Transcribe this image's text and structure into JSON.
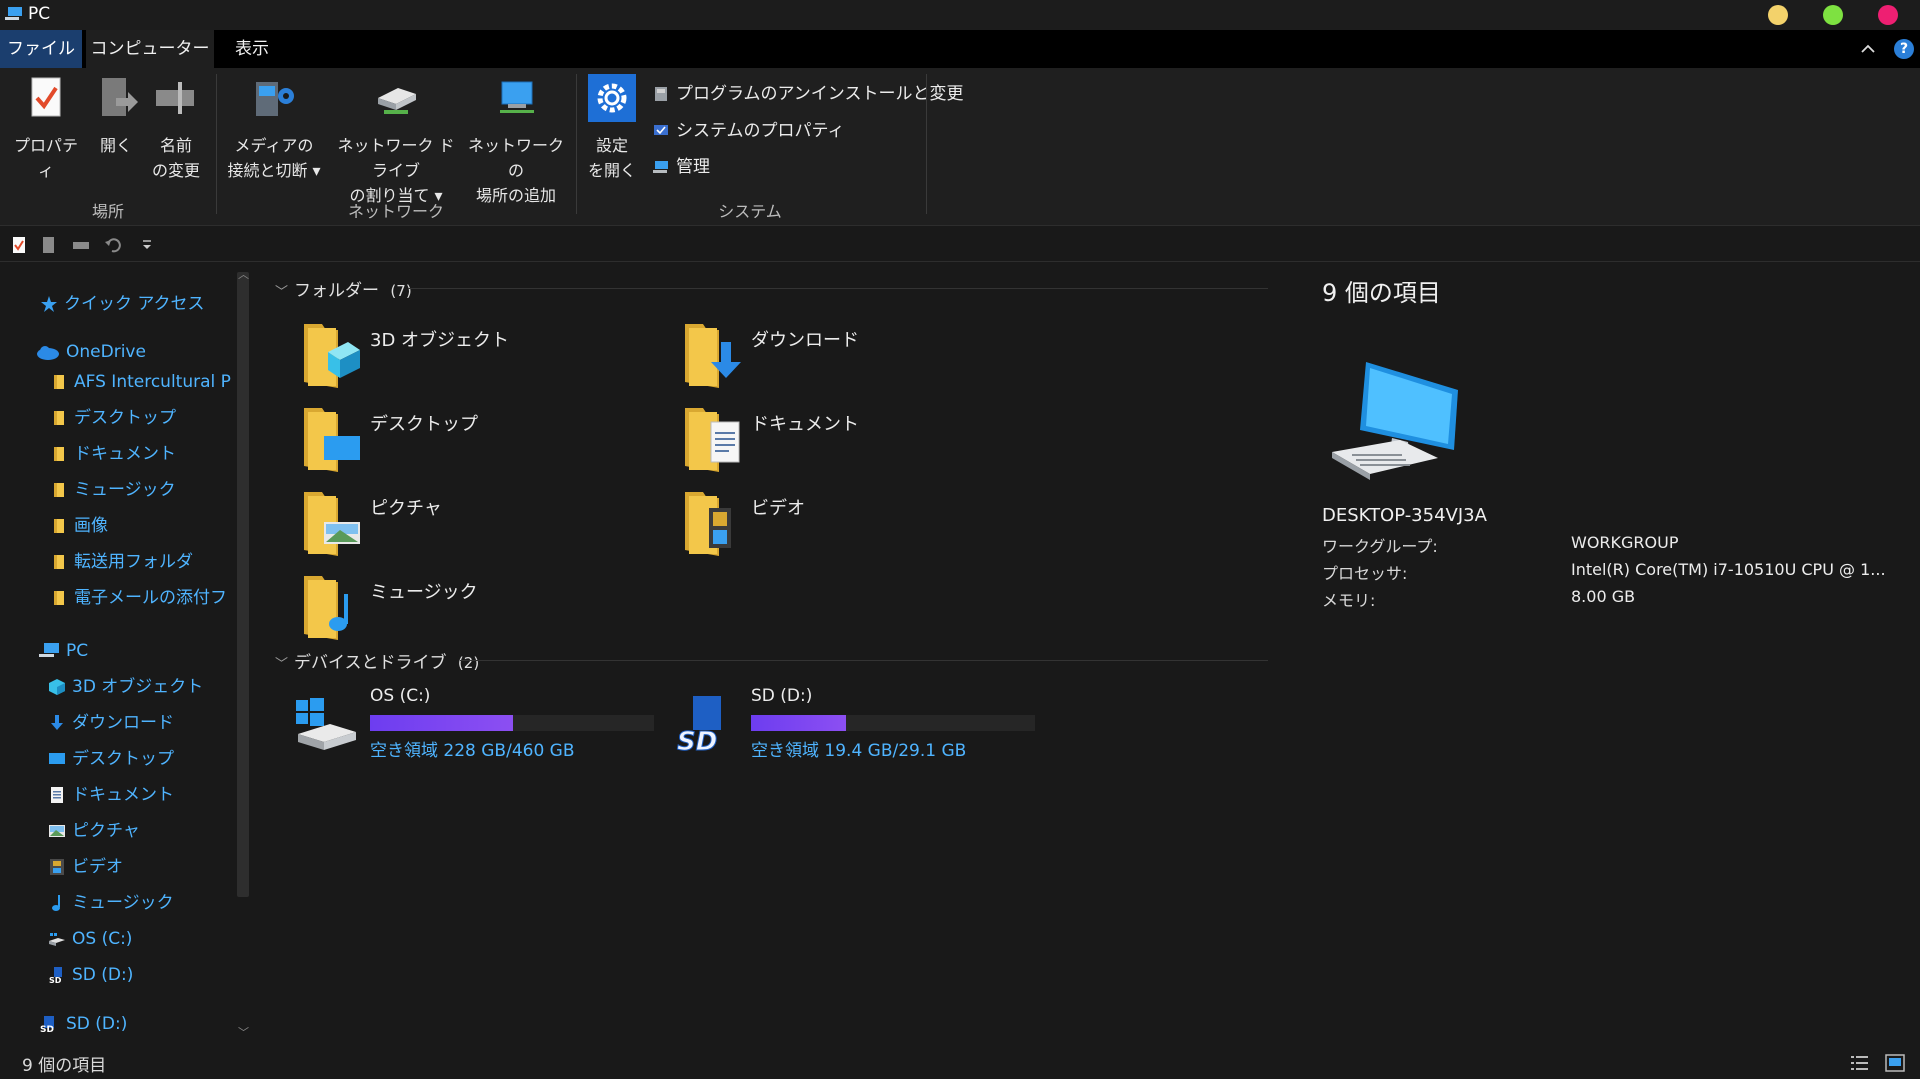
{
  "window": {
    "title": "PC"
  },
  "tabs": {
    "file": "ファイル",
    "computer": "コンピューター",
    "view": "表示"
  },
  "ribbon": {
    "location": {
      "label": "場所",
      "properties": "プロパティ",
      "open": "開く",
      "rename": "名前\nの変更"
    },
    "network": {
      "label": "ネットワーク",
      "media": "メディアの\n接続と切断 ▾",
      "map_drive": "ネットワーク ドライブ\nの割り当て ▾",
      "add_location": "ネットワークの\n場所の追加"
    },
    "system": {
      "label": "システム",
      "settings": "設定\nを開く",
      "uninstall": "プログラムのアンインストールと変更",
      "system_properties": "システムのプロパティ",
      "manage": "管理"
    }
  },
  "nav": {
    "quick_access": "クイック アクセス",
    "onedrive": "OneDrive",
    "onedrive_items": [
      "AFS Intercultural Prc",
      "デスクトップ",
      "ドキュメント",
      "ミュージック",
      "画像",
      "転送用フォルダ",
      "電子メールの添付フ"
    ],
    "pc": "PC",
    "pc_items": [
      "3D オブジェクト",
      "ダウンロード",
      "デスクトップ",
      "ドキュメント",
      "ピクチャ",
      "ビデオ",
      "ミュージック",
      "OS (C:)",
      "SD (D:)"
    ],
    "sd": "SD (D:)"
  },
  "folders": {
    "header": "フォルダー",
    "count": "(7)",
    "items": [
      "3D オブジェクト",
      "ダウンロード",
      "デスクトップ",
      "ドキュメント",
      "ピクチャ",
      "ビデオ",
      "ミュージック"
    ]
  },
  "drives": {
    "header": "デバイスとドライブ",
    "count": "(2)",
    "items": [
      {
        "name": "OS (C:)",
        "free": "空き領域 228 GB/460 GB",
        "used_fraction": 0.504
      },
      {
        "name": "SD (D:)",
        "free": "空き領域 19.4 GB/29.1 GB",
        "used_fraction": 0.333
      }
    ]
  },
  "details": {
    "title": "9 個の項目",
    "pc_name": "DESKTOP-354VJ3A",
    "workgroup_key": "ワークグループ:",
    "workgroup_val": "WORKGROUP",
    "processor_key": "プロセッサ:",
    "processor_val": "Intel(R) Core(TM) i7-10510U CPU @ 1...",
    "memory_key": "メモリ:",
    "memory_val": "8.00 GB"
  },
  "status": {
    "text": "9 個の項目"
  },
  "colors": {
    "accent": "#4fb4ff",
    "file_tab": "#1b3e6e",
    "drive_bar": "#7b45f0"
  }
}
